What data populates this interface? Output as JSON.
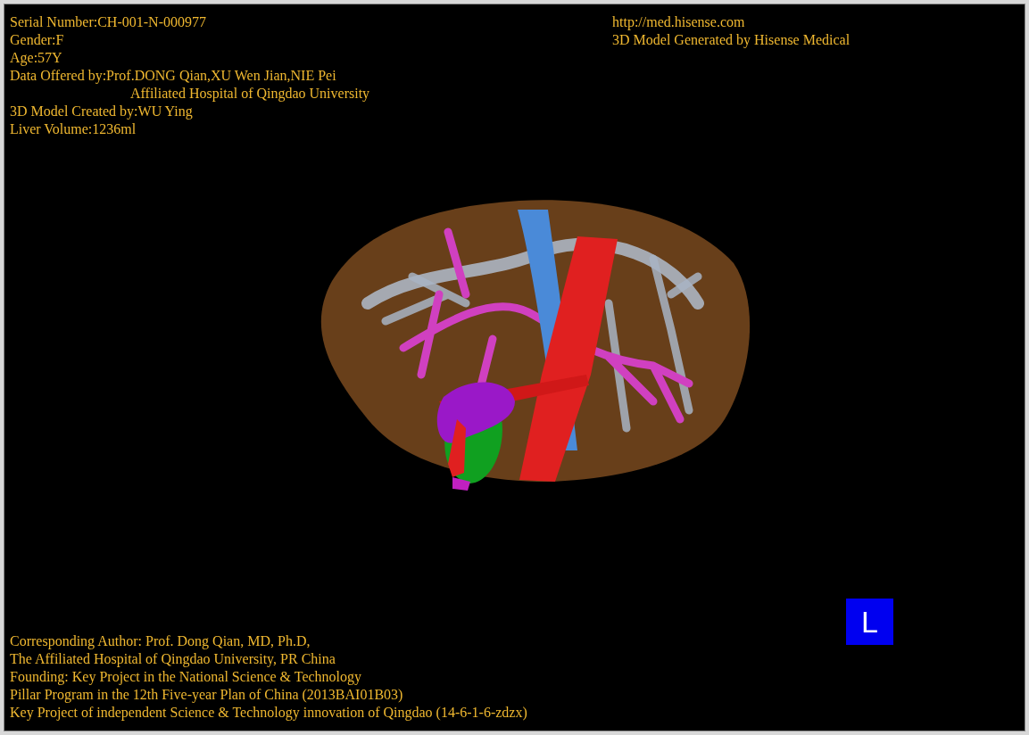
{
  "info_top_left": [
    {
      "kind": "line",
      "text": "Serial Number:CH-001-N-000977"
    },
    {
      "kind": "line",
      "text": "Gender:F"
    },
    {
      "kind": "line",
      "text": "Age:57Y"
    },
    {
      "kind": "line",
      "text": "Data Offered by:Prof.DONG Qian,XU Wen Jian,NIE Pei"
    },
    {
      "kind": "continuation",
      "text": "Affiliated Hospital of Qingdao University"
    },
    {
      "kind": "line",
      "text": "3D Model Created by:WU Ying"
    },
    {
      "kind": "line",
      "text": "Liver Volume:1236ml"
    }
  ],
  "info_top_right": [
    "http://med.hisense.com",
    "3D Model Generated by Hisense Medical"
  ],
  "orientation_marker": {
    "label": "L"
  },
  "info_bottom_left": [
    "Corresponding Author: Prof. Dong Qian, MD, Ph.D,",
    "The Affiliated Hospital of Qingdao University, PR China",
    "Founding: Key Project in the National Science & Technology",
    "Pillar Program in the 12th Five-year Plan of China (2013BAI01B03)",
    "Key Project of independent Science & Technology innovation of Qingdao (14-6-1-6-zdzx)"
  ]
}
